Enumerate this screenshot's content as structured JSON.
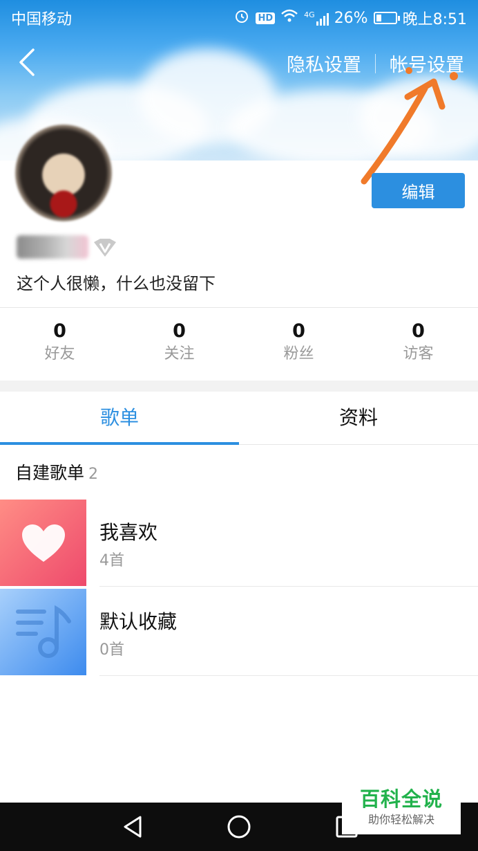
{
  "status_bar": {
    "carrier": "中国移动",
    "hd_label": "HD",
    "network": "4G",
    "battery": "26%",
    "battery_level": 0.26,
    "time": "晚上8:51"
  },
  "header": {
    "privacy_settings": "隐私设置",
    "account_settings": "帐号设置"
  },
  "profile": {
    "edit_label": "编辑",
    "bio": "这个人很懒，什么也没留下"
  },
  "stats": [
    {
      "value": "0",
      "label": "好友"
    },
    {
      "value": "0",
      "label": "关注"
    },
    {
      "value": "0",
      "label": "粉丝"
    },
    {
      "value": "0",
      "label": "访客"
    }
  ],
  "tabs": [
    {
      "label": "歌单",
      "active": true
    },
    {
      "label": "资料",
      "active": false
    }
  ],
  "section": {
    "title": "自建歌单",
    "count": "2"
  },
  "playlists": [
    {
      "name": "我喜欢",
      "count": "4首",
      "icon": "heart-icon"
    },
    {
      "name": "默认收藏",
      "count": "0首",
      "icon": "music-list-icon"
    }
  ],
  "watermark": {
    "main": "百科全说",
    "sub": "助你轻松解决"
  },
  "colors": {
    "accent": "#2c8fe0",
    "annotation": "#f07a2a",
    "watermark_green": "#22b24c"
  }
}
